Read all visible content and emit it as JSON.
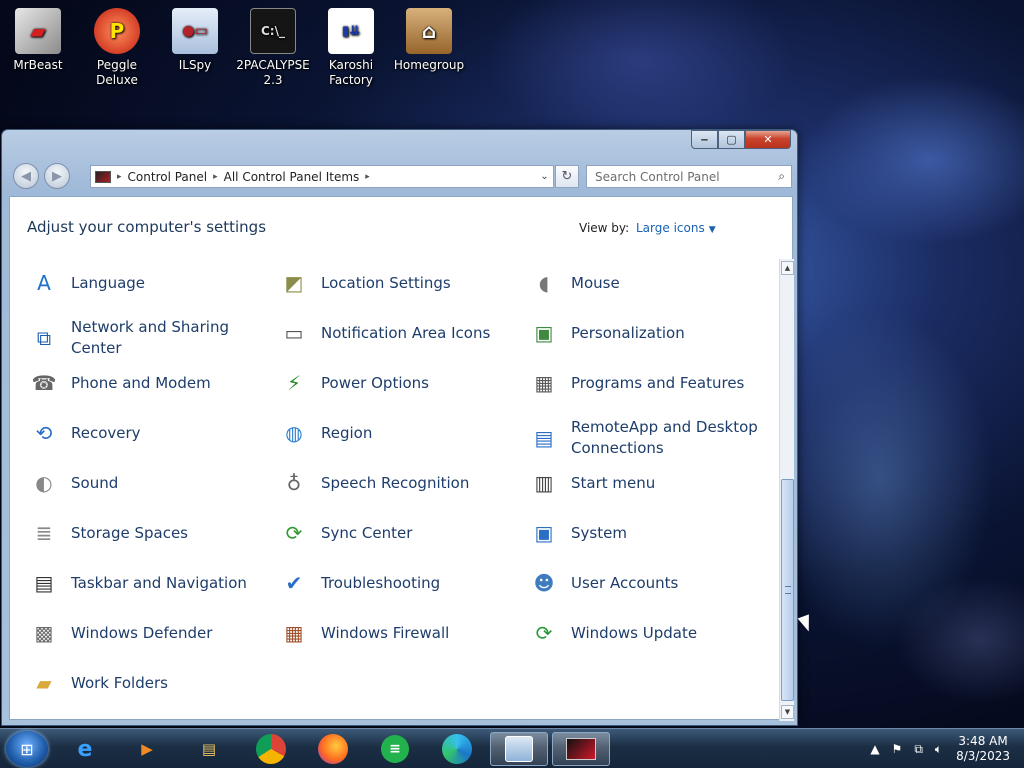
{
  "desktop": {
    "icons": [
      {
        "label": "MrBeast",
        "icon": "mrbeast-app-icon",
        "color": "#c8c8c8"
      },
      {
        "label": "Peggle Deluxe",
        "icon": "peggle-icon",
        "color": "#e8402a"
      },
      {
        "label": "ILSpy",
        "icon": "ilspy-icon",
        "color": "#c7d6ea"
      },
      {
        "label": "2PACALYPSE 2.3",
        "icon": "terminal-icon",
        "color": "#1d1d1d"
      },
      {
        "label": "Karoshi Factory",
        "icon": "karoshi-icon",
        "color": "#ffffff"
      },
      {
        "label": "Homegroup",
        "icon": "house-icon",
        "color": "#c98a3b"
      }
    ]
  },
  "window": {
    "title_buttons": {
      "minimize": "‒",
      "maximize": "▢",
      "close": "✕"
    },
    "address": {
      "root_icon": "control-panel-icon",
      "crumbs": [
        "Control Panel",
        "All Control Panel Items"
      ]
    },
    "search": {
      "placeholder": "Search Control Panel"
    },
    "heading": "Adjust your computer's settings",
    "view_by_label": "View by:",
    "view_by_value": "Large icons",
    "items": [
      {
        "label": "Language",
        "icon": "language-icon"
      },
      {
        "label": "Location Settings",
        "icon": "location-icon"
      },
      {
        "label": "Mouse",
        "icon": "mouse-icon"
      },
      {
        "label": "Network and Sharing Center",
        "icon": "network-icon"
      },
      {
        "label": "Notification Area Icons",
        "icon": "notification-icon"
      },
      {
        "label": "Personalization",
        "icon": "personalization-icon"
      },
      {
        "label": "Phone and Modem",
        "icon": "phone-icon"
      },
      {
        "label": "Power Options",
        "icon": "power-icon"
      },
      {
        "label": "Programs and Features",
        "icon": "programs-icon"
      },
      {
        "label": "Recovery",
        "icon": "recovery-icon"
      },
      {
        "label": "Region",
        "icon": "globe-icon"
      },
      {
        "label": "RemoteApp and Desktop Connections",
        "icon": "remoteapp-icon"
      },
      {
        "label": "Sound",
        "icon": "speaker-icon"
      },
      {
        "label": "Speech Recognition",
        "icon": "microphone-icon"
      },
      {
        "label": "Start menu",
        "icon": "start-menu-icon"
      },
      {
        "label": "Storage Spaces",
        "icon": "storage-icon"
      },
      {
        "label": "Sync Center",
        "icon": "sync-icon"
      },
      {
        "label": "System",
        "icon": "system-icon"
      },
      {
        "label": "Taskbar and Navigation",
        "icon": "taskbar-icon"
      },
      {
        "label": "Troubleshooting",
        "icon": "troubleshoot-icon"
      },
      {
        "label": "User Accounts",
        "icon": "users-icon"
      },
      {
        "label": "Windows Defender",
        "icon": "defender-icon"
      },
      {
        "label": "Windows Firewall",
        "icon": "firewall-icon"
      },
      {
        "label": "Windows Update",
        "icon": "update-icon"
      },
      {
        "label": "Work Folders",
        "icon": "folder-icon"
      }
    ]
  },
  "taskbar": {
    "pinned": [
      "internet-explorer-icon",
      "media-center-icon",
      "file-explorer-icon",
      "chrome-icon",
      "firefox-icon",
      "spreadsheet-icon",
      "edge-icon",
      "control-panel-icon",
      "karoshi-icon"
    ],
    "time": "3:48 AM",
    "date": "8/3/2023"
  },
  "colors": {
    "accent": "#1a61b1",
    "link": "#1e3d6b"
  }
}
